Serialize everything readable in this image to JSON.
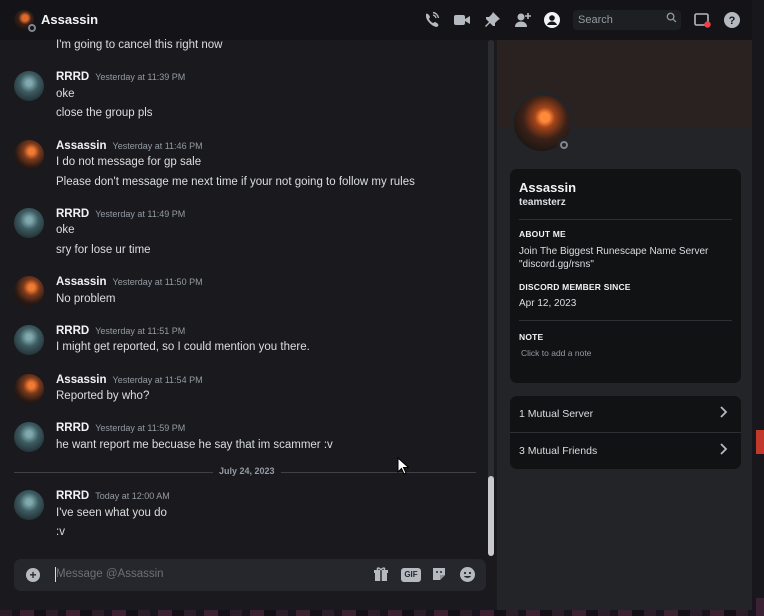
{
  "header": {
    "title": "Assassin",
    "search_placeholder": "Search"
  },
  "messages": {
    "top_line": "I'm going to cancel this right now",
    "groups": [
      {
        "author": "RRRD",
        "time": "Yesterday at 11:39 PM",
        "lines": [
          "oke",
          "close the group pls"
        ]
      },
      {
        "author": "Assassin",
        "time": "Yesterday at 11:46 PM",
        "lines": [
          "I do not message for gp sale",
          "Please don't message me next time if your not going to follow my rules"
        ]
      },
      {
        "author": "RRRD",
        "time": "Yesterday at 11:49 PM",
        "lines": [
          "oke",
          "sry for lose ur time"
        ]
      },
      {
        "author": "Assassin",
        "time": "Yesterday at 11:50 PM",
        "lines": [
          "No problem"
        ]
      },
      {
        "author": "RRRD",
        "time": "Yesterday at 11:51 PM",
        "lines": [
          "I might get reported, so I could mention you there."
        ]
      },
      {
        "author": "Assassin",
        "time": "Yesterday at 11:54 PM",
        "lines": [
          "Reported by who?"
        ]
      },
      {
        "author": "RRRD",
        "time": "Yesterday at 11:59 PM",
        "lines": [
          "he want report me becuase he say that im scammer :v"
        ]
      },
      {
        "author": "RRRD",
        "time": "Today at 12:00 AM",
        "lines": [
          "I've seen what you do",
          ":v"
        ]
      }
    ],
    "date_divider": "July 24, 2023"
  },
  "composer": {
    "placeholder": "Message @Assassin",
    "gif_label": "GIF"
  },
  "profile": {
    "display_name": "Assassin",
    "username": "teamsterz",
    "about_heading": "ABOUT ME",
    "about_text": "Join The Biggest Runescape Name Server \"discord.gg/rsns\"",
    "member_since_heading": "DISCORD MEMBER SINCE",
    "member_since": "Apr 12, 2023",
    "note_heading": "NOTE",
    "note_placeholder": "Click to add a note",
    "mutual_servers": "1 Mutual Server",
    "mutual_friends": "3 Mutual Friends"
  },
  "icons": {
    "call": "phone-call-icon",
    "video": "video-camera-icon",
    "pin": "pin-icon",
    "add_friend": "add-friend-icon",
    "profile_toggle": "user-profile-icon",
    "inbox": "inbox-icon",
    "help": "help-icon"
  }
}
